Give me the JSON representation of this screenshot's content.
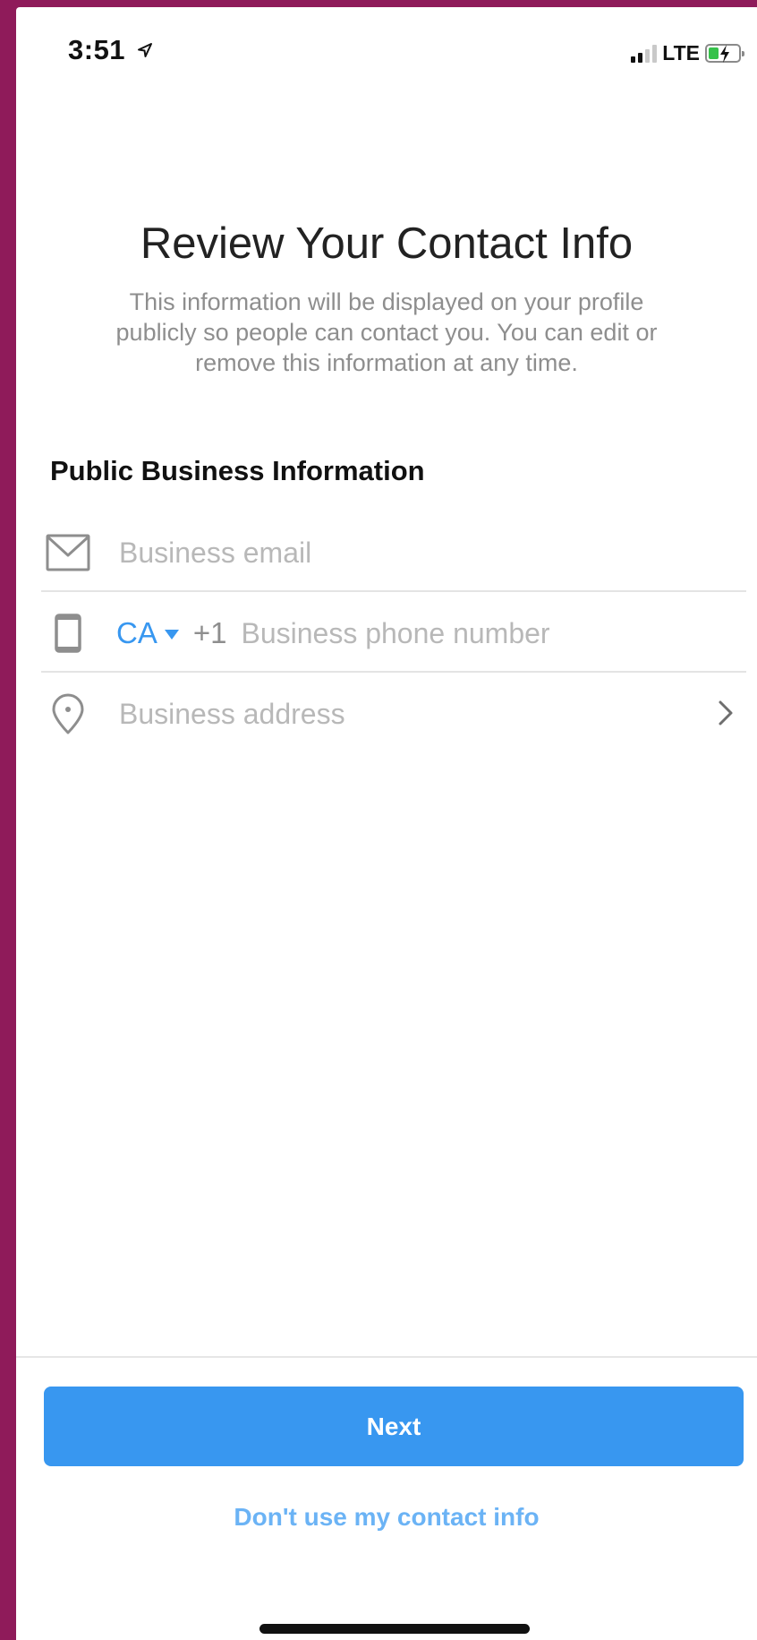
{
  "status_bar": {
    "time": "3:51",
    "network": "LTE"
  },
  "header": {
    "title": "Review Your Contact Info",
    "subtitle": "This information will be displayed on your profile publicly so people can contact you. You can edit or remove this information at any time."
  },
  "section": {
    "title": "Public Business Information"
  },
  "fields": {
    "email": {
      "placeholder": "Business email",
      "icon": "envelope-icon"
    },
    "phone": {
      "country_code": "CA",
      "dial_code": "+1",
      "placeholder": "Business phone number",
      "icon": "phone-icon"
    },
    "address": {
      "placeholder": "Business address",
      "icon": "location-pin-icon"
    }
  },
  "actions": {
    "next_label": "Next",
    "skip_label": "Don't use my contact info"
  },
  "colors": {
    "accent": "#3897f0",
    "accent_light": "#6bb3f5",
    "placeholder": "#b8b8b8",
    "frame": "#8f1b5a"
  }
}
